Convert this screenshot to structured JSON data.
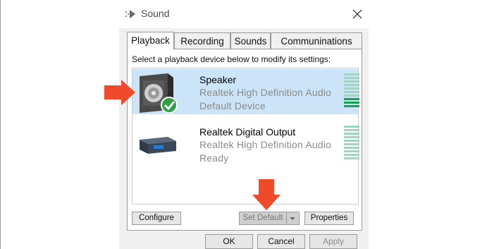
{
  "window": {
    "title": "Sound",
    "icons": {
      "app": "speaker-arrow-icon",
      "close": "close-icon"
    }
  },
  "tabs": [
    {
      "label": "Playback",
      "active": true
    },
    {
      "label": "Recording",
      "active": false
    },
    {
      "label": "Sounds",
      "active": false
    },
    {
      "label": "Communinations",
      "active": false
    }
  ],
  "panel": {
    "instruction": "Select a playback device below to modify its settings:"
  },
  "devices": [
    {
      "name": "Speaker",
      "driver": "Realtek High Definition Audio",
      "status": "Default Device",
      "selected": true,
      "icon": "speaker-device-icon",
      "badge": "default-check-icon",
      "meter_level": 0.25
    },
    {
      "name": "Realtek Digital Output",
      "driver": "Realtek High Definition Audio",
      "status": "Ready",
      "selected": false,
      "icon": "digital-output-device-icon",
      "meter_level": 0
    }
  ],
  "buttons": {
    "configure": "Configure",
    "set_default": "Set Default",
    "properties": "Properties",
    "ok": "OK",
    "cancel": "Cancel",
    "apply": "Apply"
  },
  "colors": {
    "selection": "#cce4f7",
    "meter_on": "#15a350",
    "meter_off": "#9fd6c2",
    "annotation": "#f04a2a",
    "badge": "#2ea043"
  }
}
